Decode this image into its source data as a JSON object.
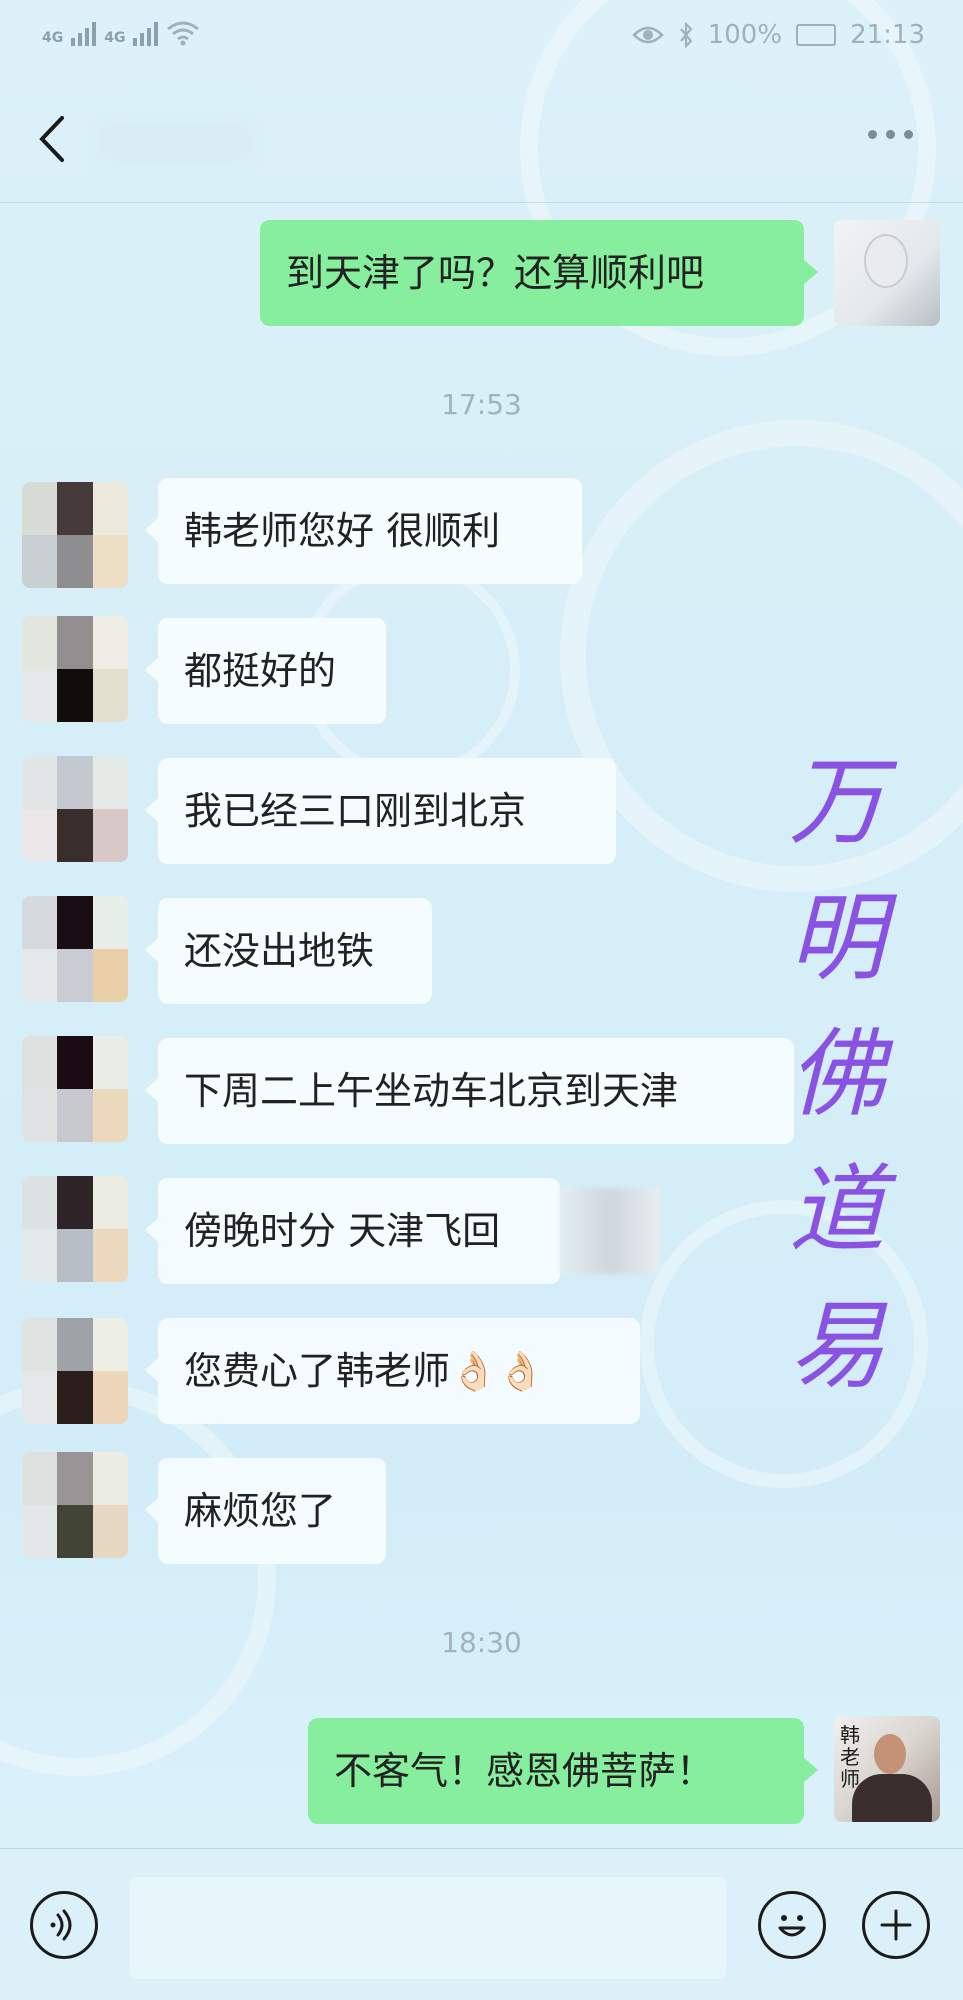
{
  "status_bar": {
    "network_1": "4G",
    "network_2": "4G",
    "battery": "100%",
    "time": "21:13"
  },
  "nav": {
    "back_icon": "chevron-left-icon",
    "more_icon": "ellipsis-icon"
  },
  "messages": [
    {
      "side": "out",
      "text": "到天津了吗？还算顺利吧"
    },
    {
      "side": "time",
      "text": "17:53"
    },
    {
      "side": "in",
      "text": "韩老师您好 很顺利"
    },
    {
      "side": "in",
      "text": "都挺好的"
    },
    {
      "side": "in",
      "text": "我已经三口刚到北京"
    },
    {
      "side": "in",
      "text": "还没出地铁"
    },
    {
      "side": "in",
      "text": "下周二上午坐动车北京到天津"
    },
    {
      "side": "in",
      "text": "傍晚时分 天津飞回"
    },
    {
      "side": "in",
      "text": "您费心了韩老师👌🏻👌🏻"
    },
    {
      "side": "in",
      "text": "麻烦您了"
    },
    {
      "side": "time",
      "text": "18:30"
    },
    {
      "side": "out",
      "text": "不客气！感恩佛菩萨！"
    }
  ],
  "watermark": [
    "万",
    "明",
    "佛",
    "道",
    "易"
  ],
  "avatar_calligraphy": "韩老师",
  "input_bar": {
    "voice_icon": "voice-icon",
    "emoji_icon": "emoji-icon",
    "plus_icon": "plus-icon",
    "input_value": ""
  },
  "colors": {
    "outgoing_bubble": "#86ee9c",
    "incoming_bubble": "#f6fcfe",
    "watermark": "#8a52e3",
    "background": "#d6eef8"
  }
}
